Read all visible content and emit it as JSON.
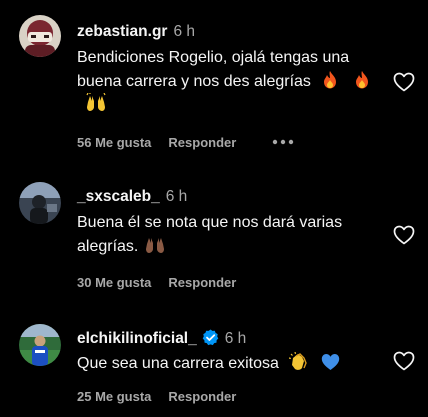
{
  "comments": [
    {
      "username": "zebastian.gr",
      "time": "6 h",
      "text": "Bendiciones Rogelio, ojalá tengas una buena carrera y nos des alegrías",
      "emojis": [
        "fire-emoji",
        "fire-emoji",
        "raising-hands-emoji"
      ],
      "likes": "56 Me gusta",
      "reply": "Responder",
      "has_more_menu": true
    },
    {
      "username": "_sxscaleb_",
      "time": "6 h",
      "text": "Buena él se nota que nos dará varias alegrías.",
      "emojis": [
        "raising-hands-emoji"
      ],
      "likes": "30 Me gusta",
      "reply": "Responder"
    },
    {
      "username": "elchikilinoficial_",
      "time": "6 h",
      "verified": true,
      "text": "Que sea una carrera exitosa",
      "emojis": [
        "clapping-hands-emoji",
        "blue-heart-emoji"
      ],
      "likes": "25 Me gusta",
      "reply": "Responder"
    }
  ],
  "colors": {
    "background": "#000000",
    "primary_text": "#f5f5f5",
    "secondary_text": "#a8a8a8",
    "verified_badge": "#0095f6"
  }
}
